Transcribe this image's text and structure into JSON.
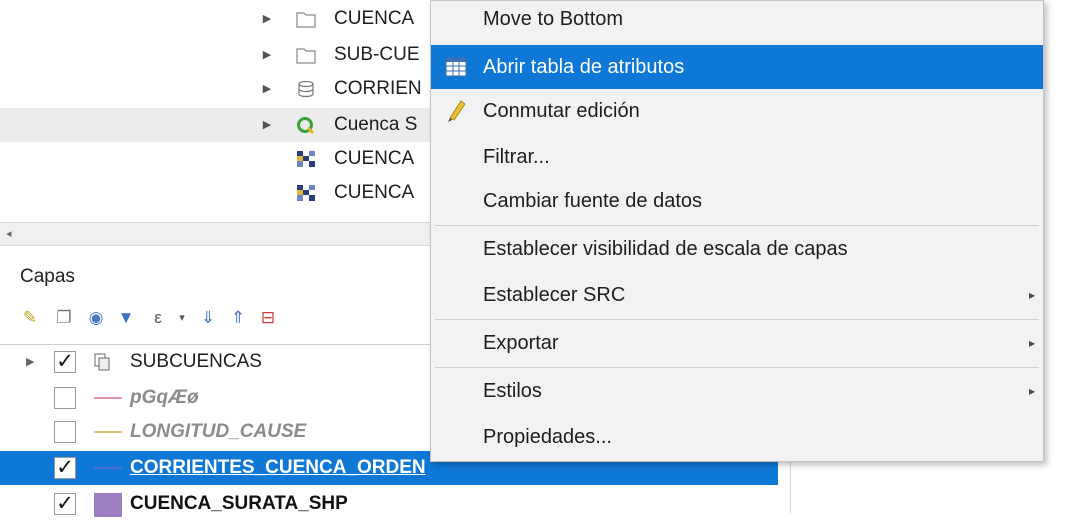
{
  "browser": {
    "rows": [
      {
        "label": "CUENCA",
        "icon": "folder-icon",
        "expandable": true
      },
      {
        "label": "SUB-CUE",
        "icon": "folder-icon",
        "expandable": true
      },
      {
        "label": "CORRIEN",
        "icon": "database-icon",
        "expandable": true
      },
      {
        "label": "Cuenca S",
        "icon": "qgis-project-icon",
        "expandable": true,
        "highlighted": true
      },
      {
        "label": "CUENCA",
        "icon": "raster-icon",
        "expandable": false
      },
      {
        "label": "CUENCA",
        "icon": "raster-icon",
        "expandable": false
      }
    ],
    "scroll_left_arrow": "◂"
  },
  "layers_panel": {
    "title": "Capas",
    "toolbar_icons": [
      "open-layer-styling-icon",
      "add-group-icon",
      "manage-visibility-icon",
      "filter-legend-icon",
      "filter-expression-icon",
      "expand-all-icon",
      "collapse-all-icon",
      "remove-layer-icon"
    ],
    "layers": [
      {
        "name": "SUBCUENCAS",
        "checked": true,
        "expandable": true,
        "symbol": "layer-group-icon"
      },
      {
        "name": "pGqÆø",
        "checked": false,
        "italic": true,
        "symbol_color": "#e58fb1"
      },
      {
        "name": "LONGITUD_CAUSE",
        "checked": false,
        "italic": true,
        "symbol_color": "#d9c06e"
      },
      {
        "name": "CORRIENTES_CUENCA_ORDEN",
        "checked": true,
        "selected": true,
        "symbol_color": "#4a6fd1"
      },
      {
        "name": "CUENCA_SURATA_SHP",
        "checked": true,
        "symbol_color": "#9b7fc0"
      }
    ],
    "check_mark": "✓"
  },
  "context_menu": {
    "items": [
      {
        "label": "Move to Bottom"
      },
      {
        "label": "Abrir tabla de atributos",
        "icon": "attribute-table-icon",
        "active": true
      },
      {
        "label": "Conmutar edición",
        "icon": "pencil-icon"
      },
      {
        "label": "Filtrar..."
      },
      {
        "label": "Cambiar fuente de datos"
      },
      {
        "label": "Establecer visibilidad de escala de capas"
      },
      {
        "label": "Establecer SRC",
        "submenu": true
      },
      {
        "label": "Exportar",
        "submenu": true
      },
      {
        "label": "Estilos",
        "submenu": true
      },
      {
        "label": "Propiedades..."
      }
    ],
    "submenu_arrow": "▸"
  },
  "colors": {
    "selection": "#0f78d7",
    "menu_bg": "#f2f2f2"
  }
}
